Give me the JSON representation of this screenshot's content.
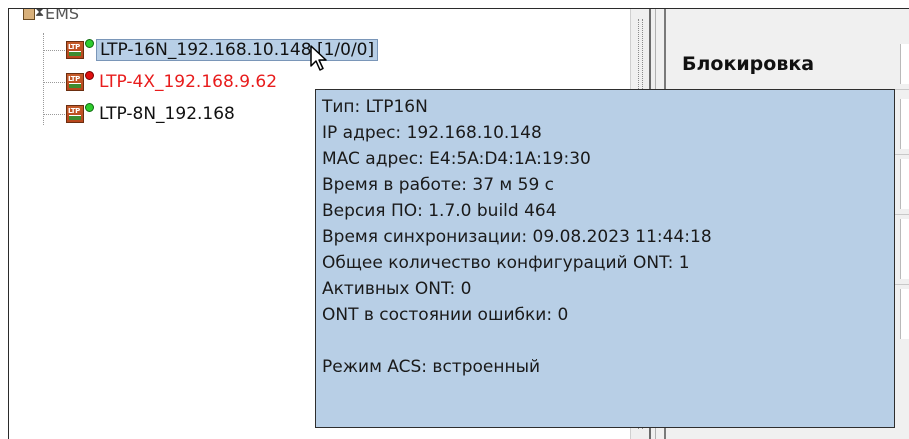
{
  "tree": {
    "root_label": "EMS",
    "nodes": [
      {
        "label": "LTP-16N_192.168.10.148 [1/0/0]",
        "status": "online",
        "selected": true
      },
      {
        "label": "LTP-4X_192.168.9.62",
        "status": "offline",
        "selected": false
      },
      {
        "label": "LTP-8N_192.168",
        "status": "online",
        "selected": false
      }
    ],
    "device_icon_text": "LTP"
  },
  "right_panel": {
    "lock_label": "Блокировка"
  },
  "tooltip": {
    "lines": [
      "Тип: LTP16N",
      "IP адрес: 192.168.10.148",
      "MAC адрес: E4:5A:D4:1A:19:30",
      "Время в работе: 37 м 59 с",
      "Версия ПО: 1.7.0 build 464",
      "Время синхронизации: 09.08.2023 11:44:18",
      "Общее количество конфигураций ONT: 1",
      "Активных ONT: 0",
      "ONT в состоянии ошибки: 0",
      "",
      "Режим ACS: встроенный"
    ]
  },
  "colors": {
    "selection_bg": "#b8cfe6",
    "tooltip_bg": "#b8cfe6",
    "offline_text": "#e81c1c",
    "online_dot": "#2ecc2e",
    "offline_dot": "#e01010"
  }
}
